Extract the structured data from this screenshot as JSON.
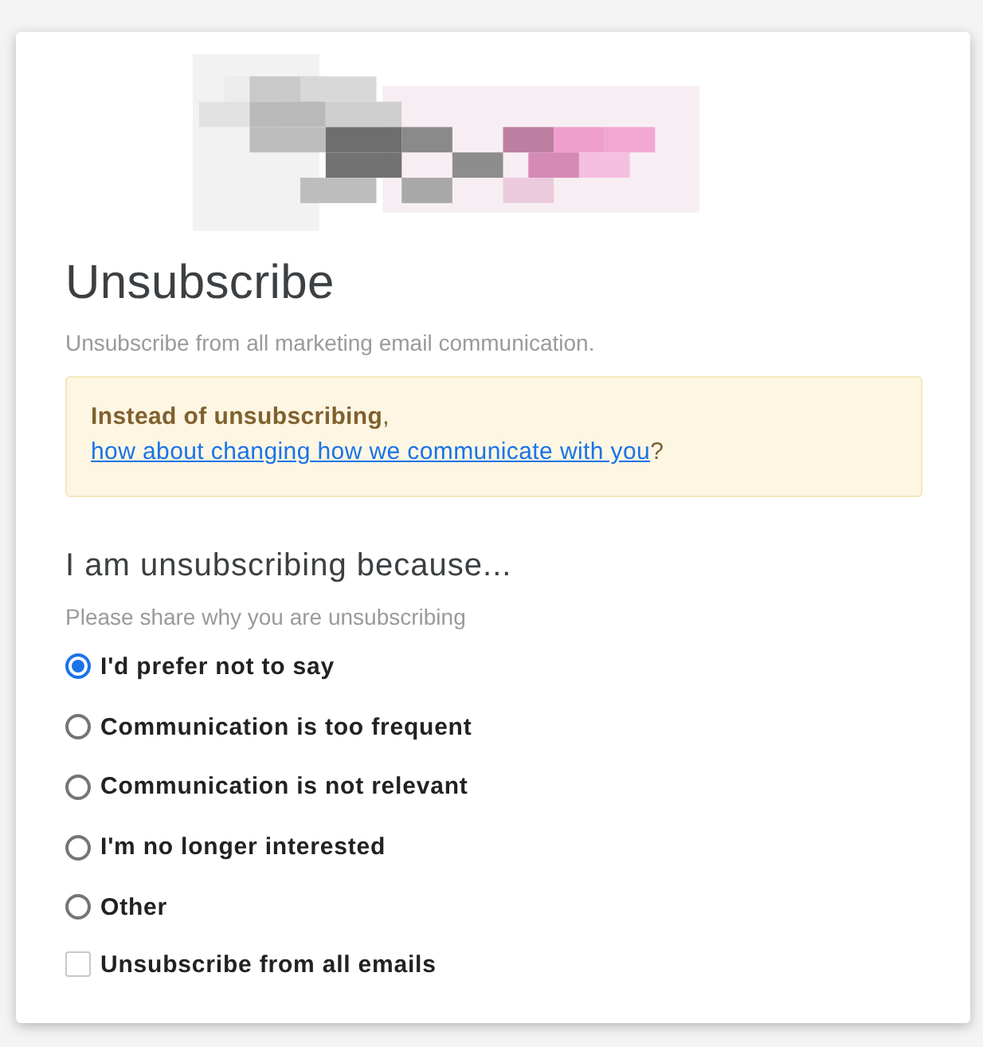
{
  "title": "Unsubscribe",
  "subtitle": "Unsubscribe from all marketing email communication.",
  "notice": {
    "text": "**Instead of unsubscribing**, ",
    "link": "how about changing how we communicate with you",
    "tail": "?"
  },
  "reasons": {
    "heading": "I am unsubscribing because...",
    "hint": "Please share why you are unsubscribing",
    "options": [
      {
        "kind": "radio",
        "label": "I'd prefer not to say",
        "selected": true
      },
      {
        "kind": "radio",
        "label": "Communication is too frequent",
        "selected": false
      },
      {
        "kind": "radio",
        "label": "Communication is not relevant",
        "selected": false
      },
      {
        "kind": "radio",
        "label": "I'm no longer interested",
        "selected": false
      },
      {
        "kind": "radio",
        "label": "Other",
        "selected": false
      },
      {
        "kind": "checkbox",
        "label": "Unsubscribe from all emails",
        "checked": false
      }
    ]
  }
}
